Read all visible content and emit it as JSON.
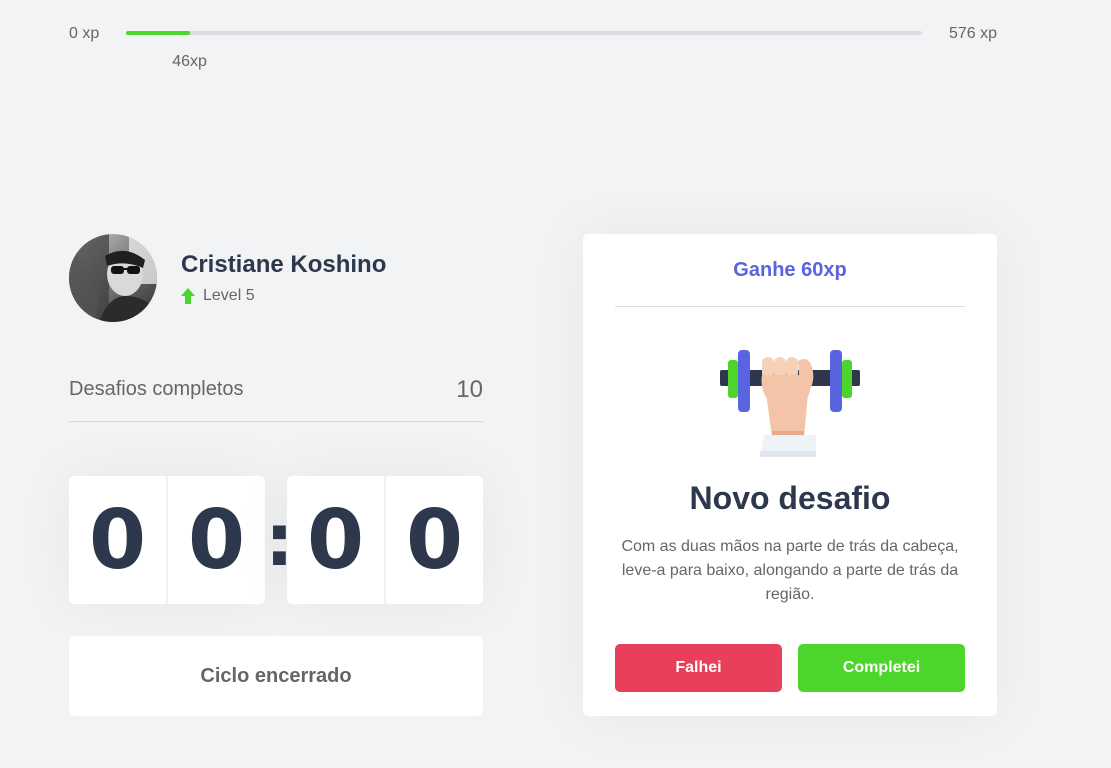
{
  "experience": {
    "min_label": "0 xp",
    "max_label": "576 xp",
    "current_label": "46xp",
    "current": 46,
    "max": 576
  },
  "profile": {
    "name": "Cristiane Koshino",
    "level_label": "Level 5"
  },
  "completed": {
    "label": "Desafios completos",
    "count": "10"
  },
  "countdown": {
    "minute_left": "0",
    "minute_right": "0",
    "separator": ":",
    "second_left": "0",
    "second_right": "0"
  },
  "cycle_button_label": "Ciclo encerrado",
  "challenge": {
    "header": "Ganhe 60xp",
    "title": "Novo desafio",
    "description": "Com as duas mãos na parte de trás da cabeça, leve-a para baixo, alongando a parte de trás da região.",
    "failed_label": "Falhei",
    "succeeded_label": "Completei",
    "icon": "dumbbell-icon"
  },
  "colors": {
    "background": "#f2f3f5",
    "title": "#2e384d",
    "text": "#666666",
    "blue": "#5965e0",
    "green": "#4cd62b",
    "red": "#e83f5b"
  }
}
